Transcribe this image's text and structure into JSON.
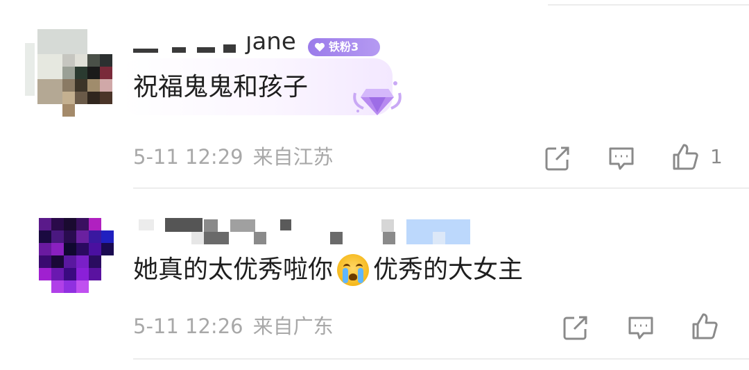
{
  "comments": [
    {
      "username_partial": "jane",
      "badge_text": "铁粉3",
      "text": "祝福鬼鬼和孩子",
      "time": "5-11 12:29",
      "location": "来自江苏",
      "like_count": "1"
    },
    {
      "text_before_emoji": "她真的太优秀啦你",
      "emoji": "crying-face",
      "text_after_emoji": "优秀的大女主",
      "time": "5-11 12:26",
      "location": "来自广东",
      "like_count": ""
    }
  ],
  "colors": {
    "meta_text": "#a8a8a8",
    "badge": "#9b7bea",
    "divider": "#ececec"
  },
  "icons": [
    "share-icon",
    "reply-icon",
    "like-icon",
    "fan-gem-icon"
  ]
}
